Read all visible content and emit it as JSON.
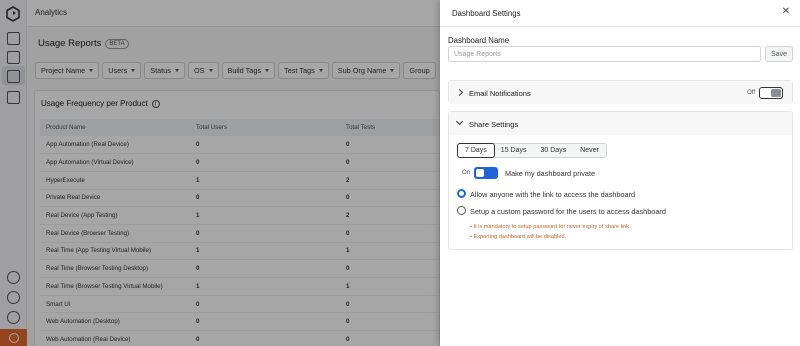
{
  "app": {
    "title": "Analytics"
  },
  "rail": {
    "icons": [
      "logo-icon",
      "dashboard-icon",
      "edit-icon",
      "reports-icon",
      "copy-icon",
      "help-icon",
      "search-icon",
      "settings-icon",
      "user-icon"
    ]
  },
  "page": {
    "title": "Usage Reports",
    "badge": "BETA",
    "filters": [
      "Project Name",
      "Users",
      "Status",
      "OS",
      "Build Tags",
      "Test Tags",
      "Sub Org Name",
      "Group"
    ]
  },
  "usage_card": {
    "title": "Usage Frequency per Product",
    "columns": [
      "Product Name",
      "Total Users",
      "Total Tests"
    ],
    "rows": [
      [
        "App Automation (Real Device)",
        "0",
        "0"
      ],
      [
        "App Automation (Virtual Device)",
        "0",
        "0"
      ],
      [
        "HyperExecute",
        "1",
        "2"
      ],
      [
        "Private Real Device",
        "0",
        "0"
      ],
      [
        "Real Device (App Testing)",
        "1",
        "2"
      ],
      [
        "Real Device (Browser Testing)",
        "0",
        "0"
      ],
      [
        "Real Time (App Testing Virtual Mobile)",
        "1",
        "1"
      ],
      [
        "Real Time (Browser Testing Desktop)",
        "0",
        "0"
      ],
      [
        "Real Time (Browser Testing Virtual Mobile)",
        "1",
        "1"
      ],
      [
        "Smart UI",
        "0",
        "0"
      ],
      [
        "Web Automation (Desktop)",
        "0",
        "0"
      ],
      [
        "Web Automation (Real Device)",
        "0",
        "0"
      ]
    ]
  },
  "panel": {
    "title": "Dashboard Settings",
    "name_label": "Dashboard Name",
    "name_placeholder": "Usage Reports",
    "save_label": "Save",
    "email": {
      "label": "Email Notifications",
      "toggle_label": "Off",
      "enabled": false
    },
    "share": {
      "label": "Share Settings",
      "durations": [
        "7 Days",
        "15 Days",
        "30 Days",
        "Never"
      ],
      "selected_duration": "7 Days",
      "private_toggle_label": "On",
      "private_label": "Make my dashboard private",
      "option_link": "Allow anyone with the link to access the dashboard",
      "option_password": "Setup a custom password for the users to access dashboard",
      "note1": "• It is mandatory to setup password for never expiry of share link.",
      "note2": "• Exporting dashboard will be disabled."
    }
  },
  "colors": {
    "accent": "#2164d8",
    "warning_note": "#c0692b",
    "brand_badge": "#e36b2e"
  }
}
